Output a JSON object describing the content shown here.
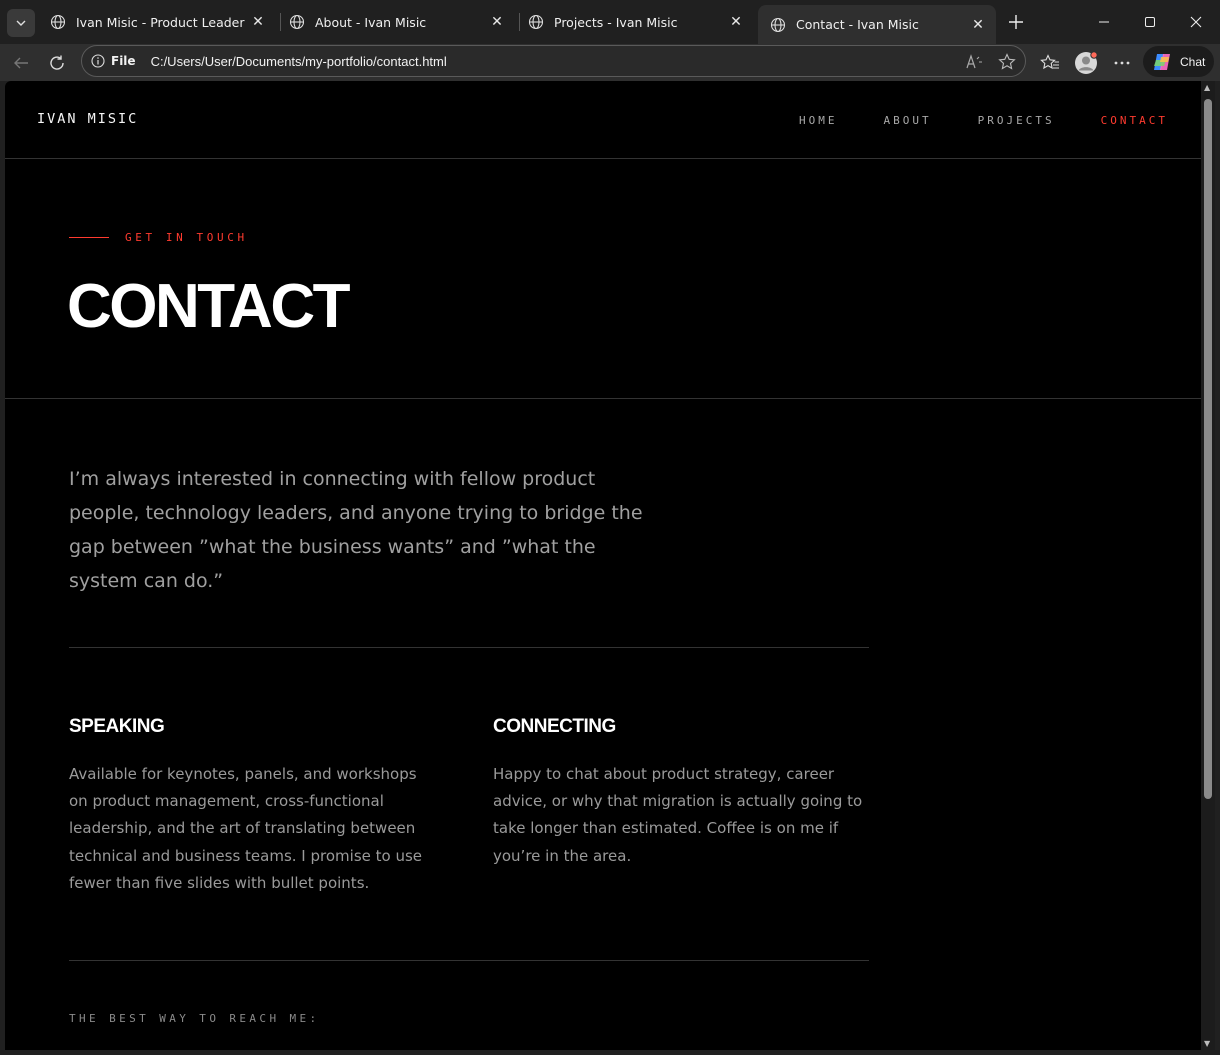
{
  "browser": {
    "tabs": [
      {
        "title": "Ivan Misic - Product Leader",
        "active": false
      },
      {
        "title": "About - Ivan Misic",
        "active": false
      },
      {
        "title": "Projects - Ivan Misic",
        "active": false
      },
      {
        "title": "Contact - Ivan Misic",
        "active": true
      }
    ],
    "address": {
      "scheme_label": "File",
      "url": "C:/Users/User/Documents/my-portfolio/contact.html"
    },
    "chat_label": "Chat",
    "icons": [
      "tab-list-icon",
      "globe-icon",
      "close-icon",
      "new-tab-icon",
      "minimize-icon",
      "maximize-icon",
      "window-close-icon",
      "back-icon",
      "refresh-icon",
      "info-icon",
      "read-aloud-icon",
      "favorite-star-icon",
      "favorites-icon",
      "profile-icon",
      "more-icon",
      "copilot-icon"
    ]
  },
  "site": {
    "brand": "IVAN MISIC",
    "nav": [
      {
        "label": "HOME",
        "current": false
      },
      {
        "label": "ABOUT",
        "current": false
      },
      {
        "label": "PROJECTS",
        "current": false
      },
      {
        "label": "CONTACT",
        "current": true
      }
    ],
    "accent_color": "#ff3b2f"
  },
  "hero": {
    "eyebrow": "GET IN TOUCH",
    "title": "CONTACT"
  },
  "intro": "I’m always interested in connecting with fellow product people, technology leaders, and anyone trying to bridge the gap between ”what the business wants” and ”what the system can do.”",
  "sections": {
    "speaking": {
      "heading": "SPEAKING",
      "body": "Available for keynotes, panels, and workshops on product management, cross-functional leadership, and the art of translating between technical and business teams. I promise to use fewer than five slides with bullet points."
    },
    "connecting": {
      "heading": "CONNECTING",
      "body": "Happy to chat about product strategy, career advice, or why that migration is actually going to take longer than estimated. Coffee is on me if you’re in the area."
    }
  },
  "reach_label": "THE BEST WAY TO REACH ME:"
}
